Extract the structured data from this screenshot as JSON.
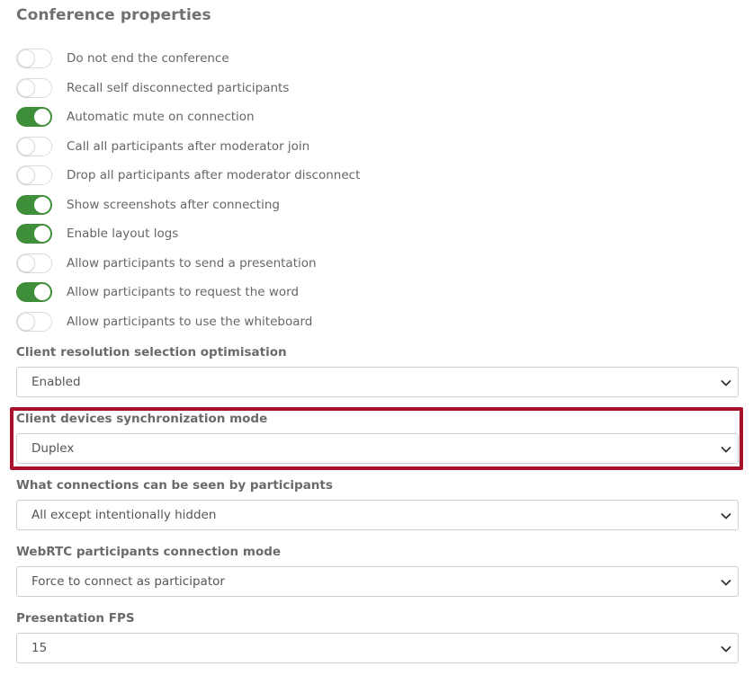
{
  "page": {
    "title": "Conference properties"
  },
  "toggles": [
    {
      "label": "Do not end the conference",
      "on": false
    },
    {
      "label": "Recall self disconnected participants",
      "on": false
    },
    {
      "label": "Automatic mute on connection",
      "on": true
    },
    {
      "label": "Call all participants after moderator join",
      "on": false
    },
    {
      "label": "Drop all participants after moderator disconnect",
      "on": false
    },
    {
      "label": "Show screenshots after connecting",
      "on": true
    },
    {
      "label": "Enable layout logs",
      "on": true
    },
    {
      "label": "Allow participants to send a presentation",
      "on": false
    },
    {
      "label": "Allow participants to request the word",
      "on": true
    },
    {
      "label": "Allow participants to use the whiteboard",
      "on": false
    }
  ],
  "fields": [
    {
      "label": "Client resolution selection optimisation",
      "value": "Enabled"
    },
    {
      "label": "Client devices synchronization mode",
      "value": "Duplex",
      "highlighted": true
    },
    {
      "label": "What connections can be seen by participants",
      "value": "All except intentionally hidden"
    },
    {
      "label": "WebRTC participants connection mode",
      "value": "Force to connect as participator"
    },
    {
      "label": "Presentation FPS",
      "value": "15"
    }
  ],
  "colors": {
    "toggle_on": "#3f8f3a",
    "highlight_border": "#a8102c"
  },
  "icons": {
    "select_arrow": "chevron-down-icon"
  }
}
